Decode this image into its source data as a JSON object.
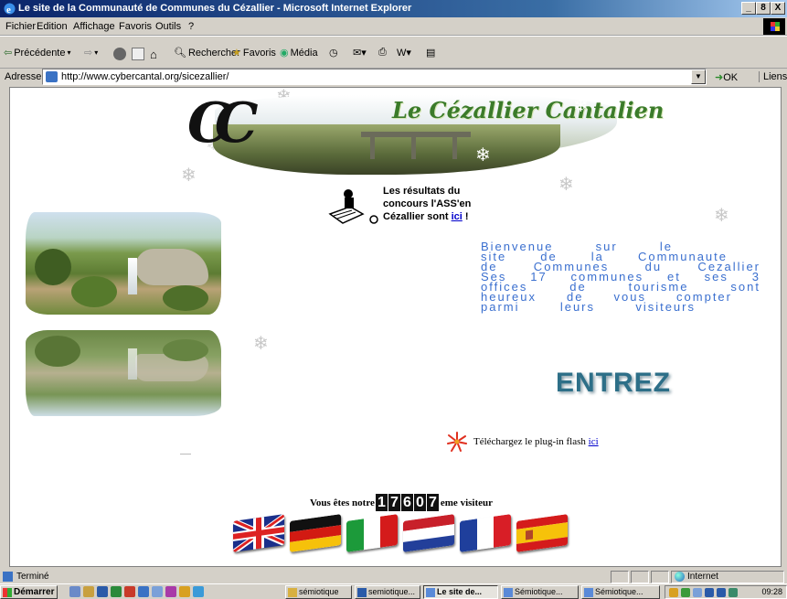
{
  "window": {
    "title": "Le site de la Communauté de Communes du Cézallier - Microsoft Internet Explorer",
    "buttons": [
      "_",
      "8",
      "X"
    ]
  },
  "menu": [
    "Fichier",
    "Edition",
    "Affichage",
    "Favoris",
    "Outils",
    "?"
  ],
  "toolbar": {
    "back_label": "Précédente",
    "search_label": "Rechercher",
    "favorites_label": "Favoris",
    "media_label": "Média"
  },
  "address": {
    "label": "Adresse",
    "url": "http://www.cybercantal.org/sicezallier/",
    "go_label": "OK",
    "links_label": "Liens"
  },
  "page": {
    "banner_title": "Le Cézallier Cantalien",
    "contest_text": "Les résultats du concours l'ASS'en Cézallier sont",
    "contest_link": "ici",
    "contest_suffix": " !",
    "welcome_lines": [
      "Bienvenue sur le",
      "site de la Communaute",
      "de Communes du Cezallier",
      "Ses 17 communes et ses 3",
      "offices de tourisme sont",
      "heureux de vous compter",
      "parmi leurs visiteurs"
    ],
    "enter_label": "ENTREZ",
    "flash_text": "Téléchargez le plug-in flash",
    "flash_link": "ici",
    "visitor_prefix": "Vous êtes notre",
    "visitor_count": [
      "1",
      "7",
      "6",
      "0",
      "7"
    ],
    "visitor_suffix": "eme visiteur",
    "flags": [
      "uk-flag",
      "germany-flag",
      "italy-flag",
      "netherlands-flag",
      "france-flag",
      "spain-flag"
    ]
  },
  "status": {
    "text": "Terminé",
    "zone": "Internet"
  },
  "taskbar": {
    "start": "Démarrer",
    "tasks": [
      "sémiotique",
      "semiotique...",
      "Le site de...",
      "Sémiotique...",
      "Sémiotique..."
    ],
    "clock": "09:28"
  }
}
